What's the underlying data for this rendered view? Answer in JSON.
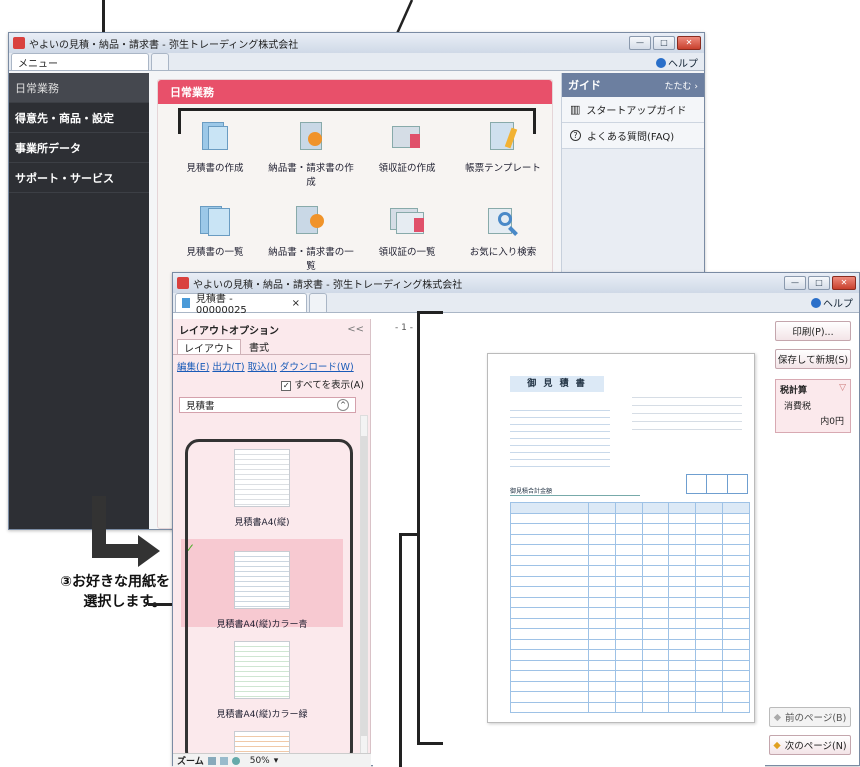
{
  "app": {
    "title": "やよいの見積・納品・請求書 - 弥生トレーディング株式会社",
    "menu_tab": "メニュー",
    "help_label": "ヘルプ",
    "sidebar": [
      "日常業務",
      "得意先・商品・設定",
      "事業所データ",
      "サポート・サービス"
    ],
    "panel_title": "日常業務",
    "tiles": [
      {
        "label": "見積書の作成",
        "icon": "estimate-create-icon"
      },
      {
        "label": "納品書・請求書の作成",
        "icon": "invoice-create-icon"
      },
      {
        "label": "領収証の作成",
        "icon": "receipt-create-icon"
      },
      {
        "label": "帳票テンプレート",
        "icon": "template-icon"
      },
      {
        "label": "見積書の一覧",
        "icon": "estimate-list-icon"
      },
      {
        "label": "納品書・請求書の一覧",
        "icon": "invoice-list-icon"
      },
      {
        "label": "領収証の一覧",
        "icon": "receipt-list-icon"
      },
      {
        "label": "お気に入り検索",
        "icon": "favorite-search-icon"
      }
    ],
    "guide": {
      "title": "ガイド",
      "fold": "たたむ",
      "items": [
        "スタートアップガイド",
        "よくある質問(FAQ)"
      ]
    }
  },
  "doc_window": {
    "title": "やよいの見積・納品・請求書 - 弥生トレーディング株式会社",
    "tab_label": "見積書 - 00000025",
    "tab_close": "×",
    "help_label": "ヘルプ",
    "layout_options": {
      "title": "レイアウトオプション",
      "collapse": "<<",
      "tabs": [
        "レイアウト",
        "書式"
      ],
      "links": [
        "編集(E)",
        "出力(T)",
        "取込(I)",
        "ダウンロード(W)"
      ],
      "show_all": "すべてを表示(A)",
      "category": "見積書",
      "papers": [
        "見積書A4(縦)",
        "見積書A4(縦)カラー青",
        "見積書A4(縦)カラー緑"
      ],
      "zoom_label": "ズーム",
      "zoom_value": "50%"
    },
    "page_marker": "- 1 -",
    "document": {
      "heading": "御 見 積 書",
      "subtotal_label": "御見積合計金額"
    },
    "right_buttons": {
      "print": "印刷(P)...",
      "save_new": "保存して新規(S)",
      "tax_title": "税計算",
      "tax_label": "消費税",
      "tax_value": "内0円",
      "prev_page": "前のページ(B)",
      "next_page": "次のページ(N)"
    }
  },
  "annotation": {
    "line1": "③お好きな用紙を",
    "line2": "選択します。"
  },
  "colors": {
    "header_red": "#e8506a",
    "sidebar_dark": "#2d2f34",
    "guide_blue": "#6c7fa0",
    "selected_pink": "#f7c9d1",
    "doc_blue": "#9ec2e6"
  }
}
